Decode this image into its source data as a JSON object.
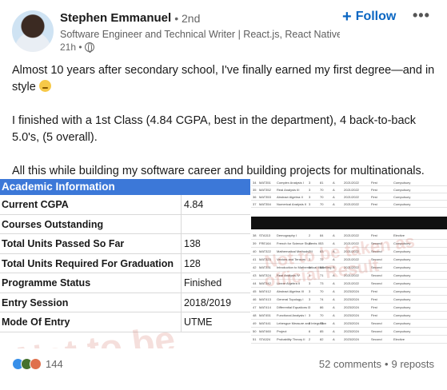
{
  "author": {
    "name": "Stephen Emmanuel",
    "connection": "• 2nd",
    "headline": "Software Engineer and Technical Writer | React.js, React Native, ...",
    "time": "21h •",
    "follow_label": "Follow",
    "more_label": "•••"
  },
  "post": {
    "paragraph1": "Almost 10 years after secondary school, I've finally earned my first degree—and in style",
    "paragraph2": "I finished with a 1st Class (4.84 CGPA, best in the department), 4 back-to-back 5.0's, (5 overall).",
    "paragraph3": "All this while building my software career and building projects for multinationals."
  },
  "academic": {
    "header": "Academic Information",
    "rows": [
      {
        "label": "Current CGPA",
        "value": "4.84"
      },
      {
        "label": "Courses Outstanding",
        "value": ""
      },
      {
        "label": "Total Units Passed So Far",
        "value": "138"
      },
      {
        "label": "Total Units Required For Graduation",
        "value": "128"
      },
      {
        "label": "Programme Status",
        "value": "Finished"
      },
      {
        "label": "Entry Session",
        "value": "2018/2019"
      },
      {
        "label": "Mode Of Entry",
        "value": "UTME"
      }
    ],
    "watermark": "Not to be"
  },
  "transcript": {
    "top_rows": [
      [
        "34",
        "MAT351",
        "Complex Analysis I",
        "3",
        "81",
        "A",
        "2021/2022",
        "First",
        "Compulsory"
      ],
      [
        "35",
        "MAT352",
        "Real Analysis III",
        "3",
        "70",
        "A",
        "2021/2022",
        "First",
        "Compulsory"
      ],
      [
        "36",
        "MAT353",
        "Abstract Algebra II",
        "3",
        "70",
        "A",
        "2021/2022",
        "First",
        "Compulsory"
      ],
      [
        "37",
        "MAT354",
        "Numerical Analysis II",
        "3",
        "70",
        "A",
        "2021/2022",
        "First",
        "Compulsory"
      ]
    ],
    "bottom_rows": [
      [
        "38",
        "STA313",
        "Demography I",
        "2",
        "84",
        "A",
        "2021/2022",
        "First",
        "Elective"
      ],
      [
        "39",
        "FRE164",
        "French for Science Students II",
        "2",
        "53",
        "A",
        "2021/2022",
        "Second",
        "Compulsory"
      ],
      [
        "40",
        "MAT322",
        "Mathematical Methods III",
        "3",
        "83",
        "A",
        "2021/2022",
        "Second",
        "Compulsory"
      ],
      [
        "41",
        "MAT323",
        "Vectors and Tensors",
        "3",
        "72",
        "A",
        "2021/2022",
        "Second",
        "Compulsory"
      ],
      [
        "42",
        "MAT331",
        "Introduction to Mathematical Modelling",
        "3",
        "63",
        "B",
        "2021/2022",
        "Second",
        "Compulsory"
      ],
      [
        "43",
        "MAT324",
        "Real Analysis IV",
        "3",
        "71",
        "A",
        "2021/2022",
        "Second",
        "Compulsory"
      ],
      [
        "44",
        "MAT342",
        "Linear Algebra II",
        "3",
        "73",
        "A",
        "2021/2022",
        "Second",
        "Compulsory"
      ],
      [
        "45",
        "MAT412",
        "Abstract Algebra III",
        "3",
        "70",
        "A",
        "2023/2024",
        "First",
        "Compulsory"
      ],
      [
        "46",
        "MAT413",
        "General Topology I",
        "3",
        "74",
        "A",
        "2023/2024",
        "First",
        "Compulsory"
      ],
      [
        "47",
        "MAT414",
        "Differential Equations I",
        "3",
        "86",
        "A",
        "2023/2024",
        "First",
        "Compulsory"
      ],
      [
        "48",
        "MAT451",
        "Functional Analysis I",
        "3",
        "70",
        "A",
        "2023/2024",
        "First",
        "Compulsory"
      ],
      [
        "49",
        "MAT441",
        "Lebesgue Measure and Integration",
        "3",
        "73",
        "A",
        "2023/2024",
        "Second",
        "Compulsory"
      ],
      [
        "50",
        "MAT460",
        "Project",
        "6",
        "85",
        "A",
        "2023/2024",
        "Second",
        "Compulsory"
      ],
      [
        "51",
        "STA324",
        "Probability Theory II",
        "2",
        "82",
        "A",
        "2023/2024",
        "Second",
        "Elective"
      ]
    ],
    "watermark_line1": "Not to be taken as",
    "watermark_line2": "official Result"
  },
  "footer": {
    "reaction_count": "144",
    "comments": "52 comments",
    "separator": "•",
    "reposts": "9 reposts"
  },
  "colors": {
    "accent": "#0a66c2",
    "academic_header": "#3c78d8"
  },
  "icons": [
    "avatar",
    "globe-icon",
    "plus-icon",
    "more-icon",
    "grin-emoji",
    "like-reaction-icon",
    "celebrate-reaction-icon",
    "love-reaction-icon"
  ]
}
